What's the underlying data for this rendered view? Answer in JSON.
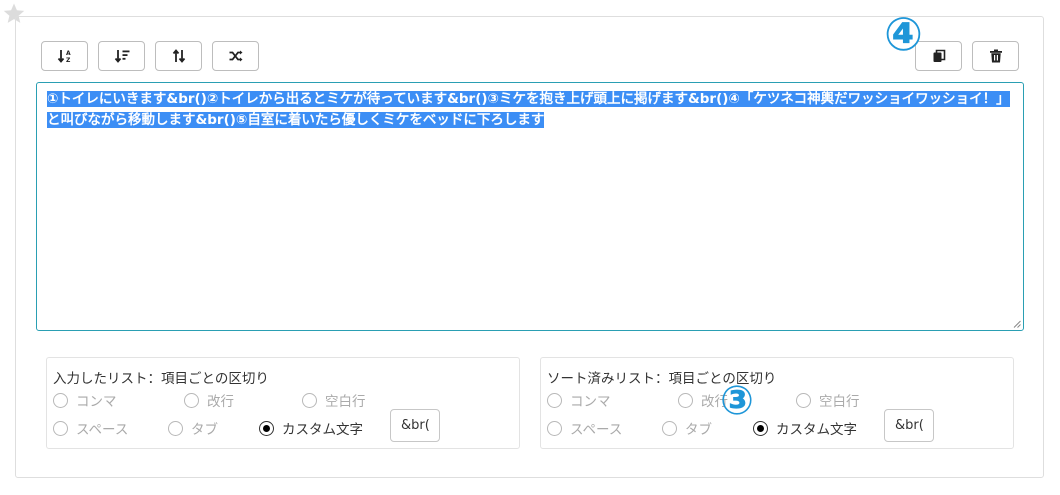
{
  "textarea": {
    "selected_text": "①トイレにいきます&br()②トイレから出るとミケが待っています&br()③ミケを抱き上げ頭上に掲げます&br()④「ケツネコ神輿だワッショイワッショイ！」と叫びながら移動します&br()⑤自室に着いたら優しくミケをベッドに下ろします"
  },
  "input_separator": {
    "title": "入力したリスト：項目ごとの区切り",
    "options": [
      "コンマ",
      "改行",
      "空白行",
      "スペース",
      "タブ",
      "カスタム文字"
    ],
    "selected": "カスタム文字",
    "custom_value": "&br("
  },
  "sorted_separator": {
    "title": "ソート済みリスト：項目ごとの区切り",
    "options": [
      "コンマ",
      "改行",
      "空白行",
      "スペース",
      "タブ",
      "カスタム文字"
    ],
    "selected": "カスタム文字",
    "custom_value": "&br("
  },
  "annotations": {
    "copy_marker": "④",
    "sorted_marker": "③"
  },
  "icons": {
    "favorite": "star-icon",
    "sort_asc": "sort-alpha-asc-icon",
    "sort_desc": "sort-amount-desc-icon",
    "reverse": "arrows-up-down-icon",
    "shuffle": "shuffle-icon",
    "copy": "copy-icon",
    "delete": "trash-icon"
  },
  "colors": {
    "selection": "#3c8ef5",
    "textarea_border": "#2a9fb3",
    "annotation": "#1e96d8"
  }
}
